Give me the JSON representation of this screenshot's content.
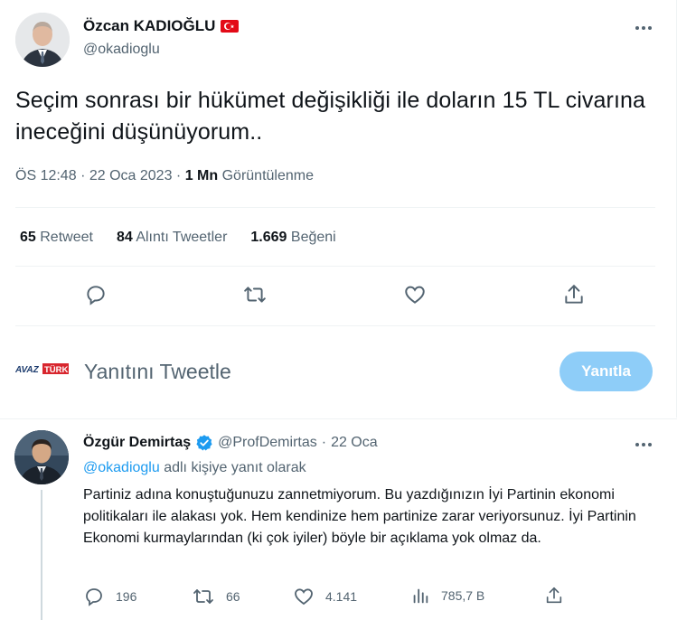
{
  "tweet": {
    "author_name": "Özcan KADIOĞLU",
    "author_handle": "@okadioglu",
    "text": "Seçim sonrası bir hükümet değişikliği ile doların 15 TL civarına ineceğini düşünüyorum..",
    "time": "ÖS 12:48",
    "date": "22 Oca 2023",
    "separator": "·",
    "views_count": "1 Mn",
    "views_label": "Görüntülenme",
    "stats": [
      {
        "count": "65",
        "label": "Retweet"
      },
      {
        "count": "84",
        "label": "Alıntı Tweetler"
      },
      {
        "count": "1.669",
        "label": "Beğeni"
      }
    ],
    "actions": [
      "reply-icon",
      "retweet-icon",
      "like-icon",
      "share-icon"
    ]
  },
  "composer": {
    "logo_text": "AVAZTÜRK",
    "placeholder": "Yanıtını Tweetle",
    "button_label": "Yanıtla",
    "button_color": "#8ecdf8"
  },
  "reply": {
    "author_name": "Özgür Demirtaş",
    "verified": true,
    "author_handle": "@ProfDemirtas",
    "separator": "·",
    "date": "22 Oca",
    "replying_to_mention": "@okadioglu",
    "replying_to_suffix": "adlı kişiye yanıt olarak",
    "text": "Partiniz adına konuştuğunuzu zannetmiyorum. Bu yazdığınızın İyi Partinin ekonomi politikaları ile alakası yok. Hem kendinize hem partinize zarar veriyorsunuz. İyi Partinin Ekonomi kurmaylarından (ki çok iyiler) böyle bir açıklama yok olmaz da.",
    "actions": {
      "replies": "196",
      "retweets": "66",
      "likes": "4.141",
      "views": "785,7 B"
    }
  },
  "colors": {
    "accent": "#1d9bf0",
    "text_primary": "#0f1419",
    "text_secondary": "#536471",
    "divider": "#eff3f4",
    "retweet_green": "#00ba7c"
  }
}
